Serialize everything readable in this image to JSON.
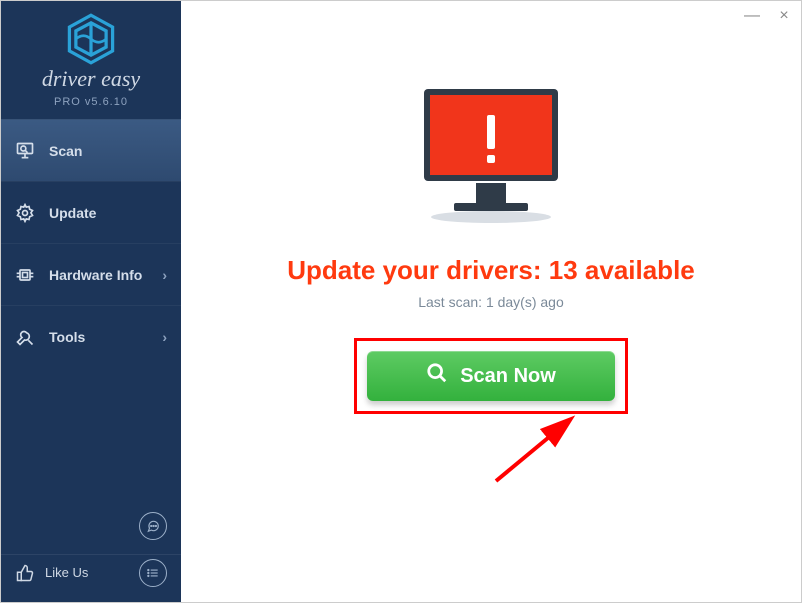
{
  "window": {
    "minimize": "—",
    "close": "×"
  },
  "brand": {
    "name": "driver easy",
    "subtitle": "PRO v5.6.10"
  },
  "sidebar": {
    "items": [
      {
        "label": "Scan",
        "icon": "search-monitor-icon",
        "active": true,
        "chevron": false
      },
      {
        "label": "Update",
        "icon": "gear-icon",
        "active": false,
        "chevron": false
      },
      {
        "label": "Hardware Info",
        "icon": "chip-icon",
        "active": false,
        "chevron": true
      },
      {
        "label": "Tools",
        "icon": "tools-icon",
        "active": false,
        "chevron": true
      }
    ],
    "likeUs": "Like Us"
  },
  "main": {
    "headline_prefix": "Update your drivers: ",
    "available_count": 13,
    "headline_suffix": " available",
    "last_scan": "Last scan: 1 day(s) ago",
    "scan_button": "Scan Now"
  },
  "colors": {
    "sidebar_bg": "#1c3559",
    "accent": "#26a1da",
    "danger": "#ff3a0f",
    "scan_green": "#33b13d"
  }
}
